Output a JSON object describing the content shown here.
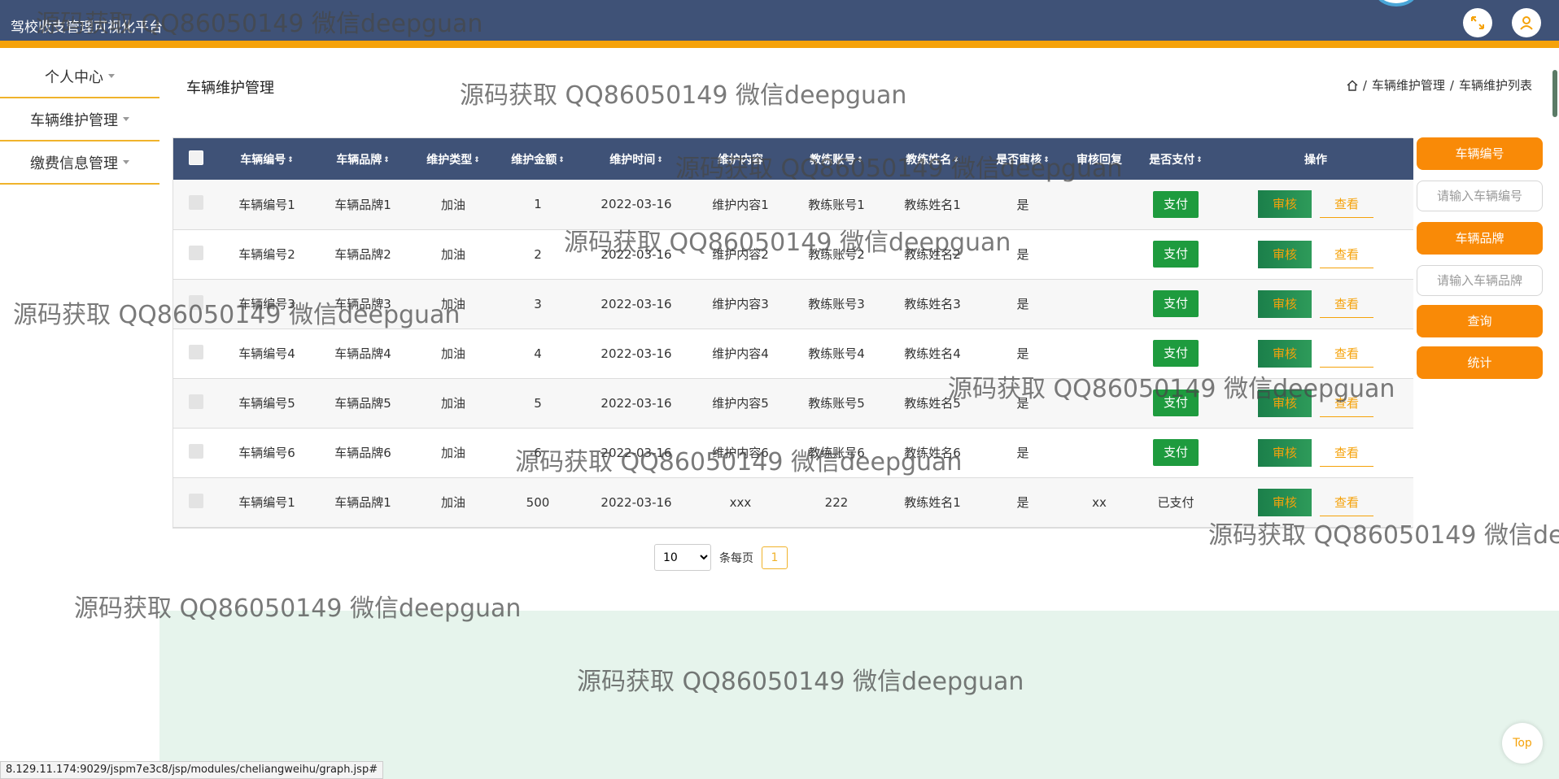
{
  "header": {
    "title": "驾校收支管理可视化平台"
  },
  "sidebar": {
    "items": [
      {
        "label": "个人中心"
      },
      {
        "label": "车辆维护管理"
      },
      {
        "label": "缴费信息管理"
      }
    ]
  },
  "page": {
    "title": "车辆维护管理"
  },
  "breadcrumb": {
    "items": [
      "车辆维护管理",
      "车辆维护列表"
    ],
    "separator": "/"
  },
  "table": {
    "headers": [
      "车辆编号",
      "车辆品牌",
      "维护类型",
      "维护金额",
      "维护时间",
      "维护内容",
      "教练账号",
      "教练姓名",
      "是否审核",
      "审核回复",
      "是否支付",
      "操作"
    ],
    "rows": [
      {
        "no": "车辆编号1",
        "brand": "车辆品牌1",
        "type": "加油",
        "amount": "1",
        "time": "2022-03-16",
        "content": "维护内容1",
        "account": "教练账号1",
        "name": "教练姓名1",
        "audited": "是",
        "reply": "",
        "paid": "支付",
        "paid_button": true
      },
      {
        "no": "车辆编号2",
        "brand": "车辆品牌2",
        "type": "加油",
        "amount": "2",
        "time": "2022-03-16",
        "content": "维护内容2",
        "account": "教练账号2",
        "name": "教练姓名2",
        "audited": "是",
        "reply": "",
        "paid": "支付",
        "paid_button": true
      },
      {
        "no": "车辆编号3",
        "brand": "车辆品牌3",
        "type": "加油",
        "amount": "3",
        "time": "2022-03-16",
        "content": "维护内容3",
        "account": "教练账号3",
        "name": "教练姓名3",
        "audited": "是",
        "reply": "",
        "paid": "支付",
        "paid_button": true
      },
      {
        "no": "车辆编号4",
        "brand": "车辆品牌4",
        "type": "加油",
        "amount": "4",
        "time": "2022-03-16",
        "content": "维护内容4",
        "account": "教练账号4",
        "name": "教练姓名4",
        "audited": "是",
        "reply": "",
        "paid": "支付",
        "paid_button": true
      },
      {
        "no": "车辆编号5",
        "brand": "车辆品牌5",
        "type": "加油",
        "amount": "5",
        "time": "2022-03-16",
        "content": "维护内容5",
        "account": "教练账号5",
        "name": "教练姓名5",
        "audited": "是",
        "reply": "",
        "paid": "支付",
        "paid_button": true
      },
      {
        "no": "车辆编号6",
        "brand": "车辆品牌6",
        "type": "加油",
        "amount": "6",
        "time": "2022-03-16",
        "content": "维护内容6",
        "account": "教练账号6",
        "name": "教练姓名6",
        "audited": "是",
        "reply": "",
        "paid": "支付",
        "paid_button": true
      },
      {
        "no": "车辆编号1",
        "brand": "车辆品牌1",
        "type": "加油",
        "amount": "500",
        "time": "2022-03-16",
        "content": "xxx",
        "account": "222",
        "name": "教练姓名1",
        "audited": "是",
        "reply": "xx",
        "paid": "已支付",
        "paid_button": false
      }
    ],
    "action_audit": "审核",
    "action_view": "查看"
  },
  "search": {
    "vehicle_no_label": "车辆编号",
    "vehicle_no_placeholder": "请输入车辆编号",
    "brand_label": "车辆品牌",
    "brand_placeholder": "请输入车辆品牌",
    "query_button": "查询",
    "stats_button": "统计"
  },
  "pagination": {
    "page_size": "10",
    "page_size_options": [
      "10"
    ],
    "per_page_label": "条每页",
    "current_page": "1"
  },
  "status_url": "8.129.11.174:9029/jspm7e3c8/jsp/modules/cheliangweihu/graph.jsp#",
  "top_button": "Top",
  "watermark": "源码获取 QQ86050149 微信deepguan",
  "colors": {
    "header_bg": "#3f5277",
    "accent": "#f5a20a",
    "search_button": "#f98a07",
    "pay_button": "#1e9b3e",
    "chart_bg": "#e6f4ec"
  },
  "icons": {
    "fullscreen": "fullscreen-icon",
    "user": "user-icon",
    "home": "home-icon"
  }
}
